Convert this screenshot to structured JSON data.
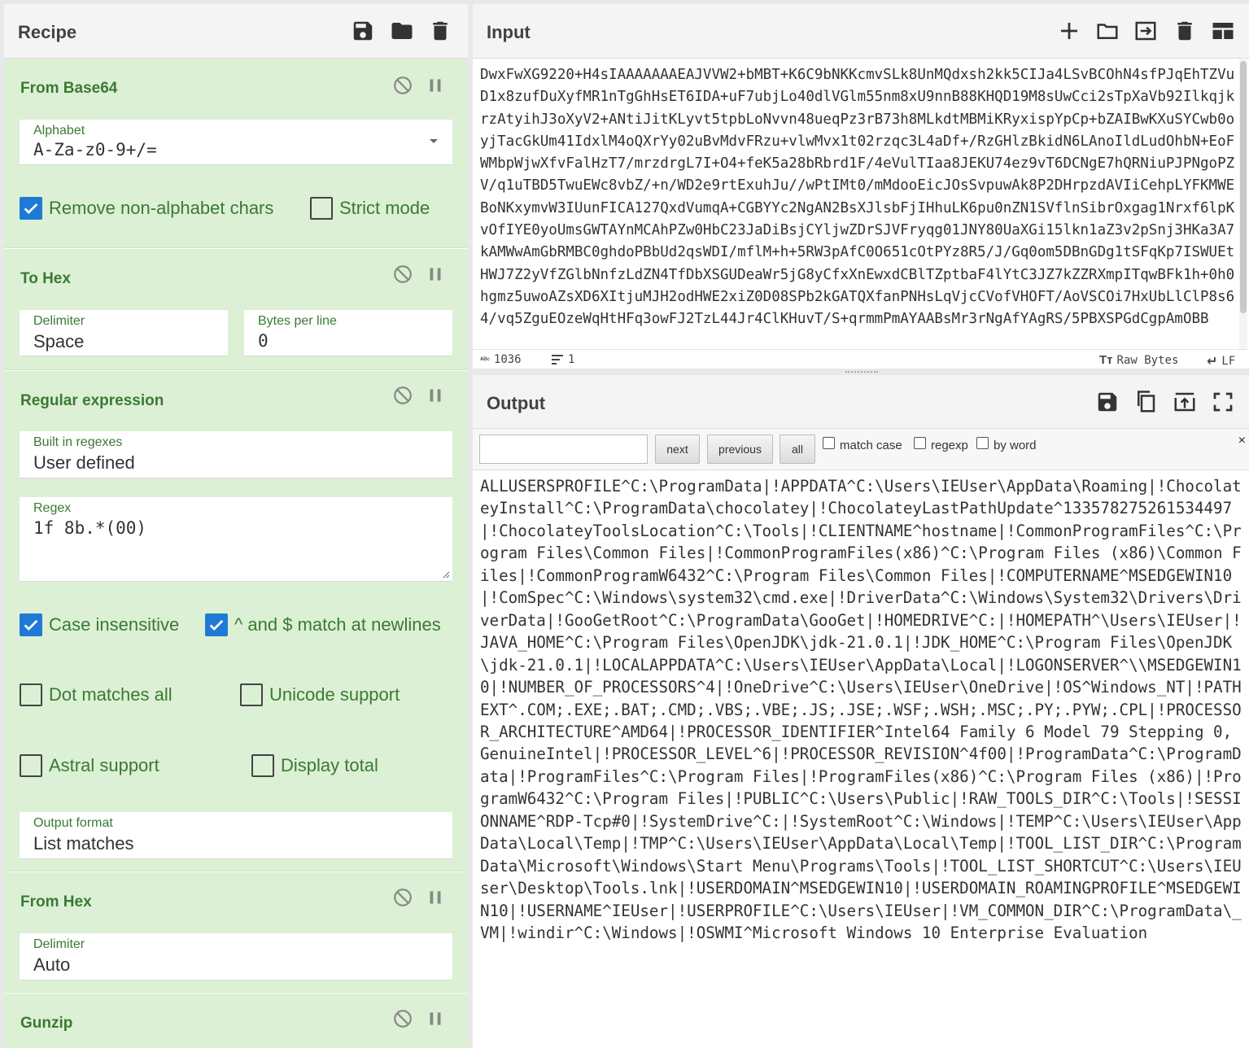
{
  "recipe": {
    "title": "Recipe",
    "icons": [
      "save-icon",
      "folder-icon",
      "trash-icon"
    ],
    "operations": {
      "from_base64": {
        "title": "From Base64",
        "alphabet_label": "Alphabet",
        "alphabet_value": "A-Za-z0-9+/=",
        "remove_nonalpha_label": "Remove non-alphabet chars",
        "remove_nonalpha_checked": true,
        "strict_mode_label": "Strict mode",
        "strict_mode_checked": false
      },
      "to_hex": {
        "title": "To Hex",
        "delimiter_label": "Delimiter",
        "delimiter_value": "Space",
        "bytes_label": "Bytes per line",
        "bytes_value": "0"
      },
      "regex": {
        "title": "Regular expression",
        "builtin_label": "Built in regexes",
        "builtin_value": "User defined",
        "regex_label": "Regex",
        "regex_value": "1f 8b.*(00)",
        "case_insensitive_label": "Case insensitive",
        "case_insensitive_checked": true,
        "newline_label": "^ and $ match at newlines",
        "newline_checked": true,
        "dot_all_label": "Dot matches all",
        "dot_all_checked": false,
        "unicode_label": "Unicode support",
        "unicode_checked": false,
        "astral_label": "Astral support",
        "astral_checked": false,
        "display_total_label": "Display total",
        "display_total_checked": false,
        "output_format_label": "Output format",
        "output_format_value": "List matches"
      },
      "from_hex": {
        "title": "From Hex",
        "delimiter_label": "Delimiter",
        "delimiter_value": "Auto"
      },
      "gunzip": {
        "title": "Gunzip"
      }
    }
  },
  "input": {
    "title": "Input",
    "text": "DwxFwXG9220+H4sIAAAAAAAEAJVVW2+bMBT+K6C9bNKKcmvSLk8UnMQdxsh2kk5CIJa4LSvBCOhN4sfPJqEhTZVuD1x8zufDuXyfMR1nTgGhHsET6IDA+uF7ubjLo40dlVGlm55nm8xU9nnB88KHQD19M8sUwCci2sTpXaVb92IlkqjkrzAtyihJ3oXyV2+ANtiJitKLyvt5tpbLoNvvn48ueqPz3rB73h8MLkdtMBMiKRyxispYpCp+bZAIBwKXuSYCwb0oyjTacGkUm41IdxlM4oQXrYy02uBvMdvFRzu+vlwMvx1t02rzqc3L4aDf+/RzGHlzBkidN6LAnoIldLudOhbN+EoFWMbpWjwXfvFalHzT7/mrzdrgL7I+O4+feK5a28bRbrd1F/4eVulTIaa8JEKU74ez9vT6DCNgE7hQRNiuPJPNgoPZV/q1uTBD5TwuEWc8vbZ/+n/WD2e9rtExuhJu//wPtIMt0/mMdooEicJOsSvpuwAk8P2DHrpzdAVIiCehpLYFKMWEBoNKxymvW3IUunFICA127QxdVumqA+CGBYYc2NgAN2BsXJlsbFjIHhuLK6pu0nZN1SVflnSibrOxgag1Nrxf6lpKvOfIYE0yoUmsGWTAYnMCAhPZw0HbC23JaDiBsjCYljwZDrSJVFryqg01JNY80UaXGi15lkn1aZ3v2pSnj3HKa3A7kAMWwAmGbRMBC0ghdoPBbUd2qsWDI/mflM+h+5RW3pAfC0O651cOtPYz8R5/J/Gq0om5DBnGDg1tSFqKp7ISWUEtHWJ7Z2yVfZGlbNnfzLdZN4TfDbXSGUDeaWr5jG8yCfxXnEwxdCBlTZptbaF4lYtC3JZ7kZZRXmpITqwBFk1h+0h0hgmz5uwoAZsXD6XItjuMJH2odHWE2xiZ0D08SPb2kGATQXfanPNHsLqVjcCVofVHOFT/AoVSCOi7HxUbLlClP8s64/vq5ZguEOzeWqHtHFq3owFJ2TzL44Jr4ClKHuvT/S+qrmmPmAYAABsMr3rNgAfYAgRS/5PBXSPGdCgpAmOBB",
    "status": {
      "chars_value": "1036",
      "lines_value": "1",
      "raw_bytes_label": "Raw Bytes",
      "eol_label": "LF"
    }
  },
  "output": {
    "title": "Output",
    "search": {
      "next_label": "next",
      "previous_label": "previous",
      "all_label": "all",
      "match_case_label": "match case",
      "regexp_label": "regexp",
      "by_word_label": "by word",
      "close_label": "×"
    },
    "text": "ALLUSERSPROFILE^C:\\ProgramData|!APPDATA^C:\\Users\\IEUser\\AppData\\Roaming|!ChocolateyInstall^C:\\ProgramData\\chocolatey|!ChocolateyLastPathUpdate^133578275261534497|!ChocolateyToolsLocation^C:\\Tools|!CLIENTNAME^hostname|!CommonProgramFiles^C:\\Program Files\\Common Files|!CommonProgramFiles(x86)^C:\\Program Files (x86)\\Common Files|!CommonProgramW6432^C:\\Program Files\\Common Files|!COMPUTERNAME^MSEDGEWIN10|!ComSpec^C:\\Windows\\system32\\cmd.exe|!DriverData^C:\\Windows\\System32\\Drivers\\DriverData|!GooGetRoot^C:\\ProgramData\\GooGet|!HOMEDRIVE^C:|!HOMEPATH^\\Users\\IEUser|!JAVA_HOME^C:\\Program Files\\OpenJDK\\jdk-21.0.1|!JDK_HOME^C:\\Program Files\\OpenJDK\\jdk-21.0.1|!LOCALAPPDATA^C:\\Users\\IEUser\\AppData\\Local|!LOGONSERVER^\\\\MSEDGEWIN10|!NUMBER_OF_PROCESSORS^4|!OneDrive^C:\\Users\\IEUser\\OneDrive|!OS^Windows_NT|!PATHEXT^.COM;.EXE;.BAT;.CMD;.VBS;.VBE;.JS;.JSE;.WSF;.WSH;.MSC;.PY;.PYW;.CPL|!PROCESSOR_ARCHITECTURE^AMD64|!PROCESSOR_IDENTIFIER^Intel64 Family 6 Model 79 Stepping 0, GenuineIntel|!PROCESSOR_LEVEL^6|!PROCESSOR_REVISION^4f00|!ProgramData^C:\\ProgramData|!ProgramFiles^C:\\Program Files|!ProgramFiles(x86)^C:\\Program Files (x86)|!ProgramW6432^C:\\Program Files|!PUBLIC^C:\\Users\\Public|!RAW_TOOLS_DIR^C:\\Tools|!SESSIONNAME^RDP-Tcp#0|!SystemDrive^C:|!SystemRoot^C:\\Windows|!TEMP^C:\\Users\\IEUser\\AppData\\Local\\Temp|!TMP^C:\\Users\\IEUser\\AppData\\Local\\Temp|!TOOL_LIST_DIR^C:\\ProgramData\\Microsoft\\Windows\\Start Menu\\Programs\\Tools|!TOOL_LIST_SHORTCUT^C:\\Users\\IEUser\\Desktop\\Tools.lnk|!USERDOMAIN^MSEDGEWIN10|!USERDOMAIN_ROAMINGPROFILE^MSEDGEWIN10|!USERNAME^IEUser|!USERPROFILE^C:\\Users\\IEUser|!VM_COMMON_DIR^C:\\ProgramData\\_VM|!windir^C:\\Windows|!OSWMI^Microsoft Windows 10 Enterprise Evaluation"
  },
  "colors": {
    "accent_green": "#3a7a33",
    "op_background": "#dcf0d5",
    "checkbox_blue": "#1f7ad6"
  }
}
